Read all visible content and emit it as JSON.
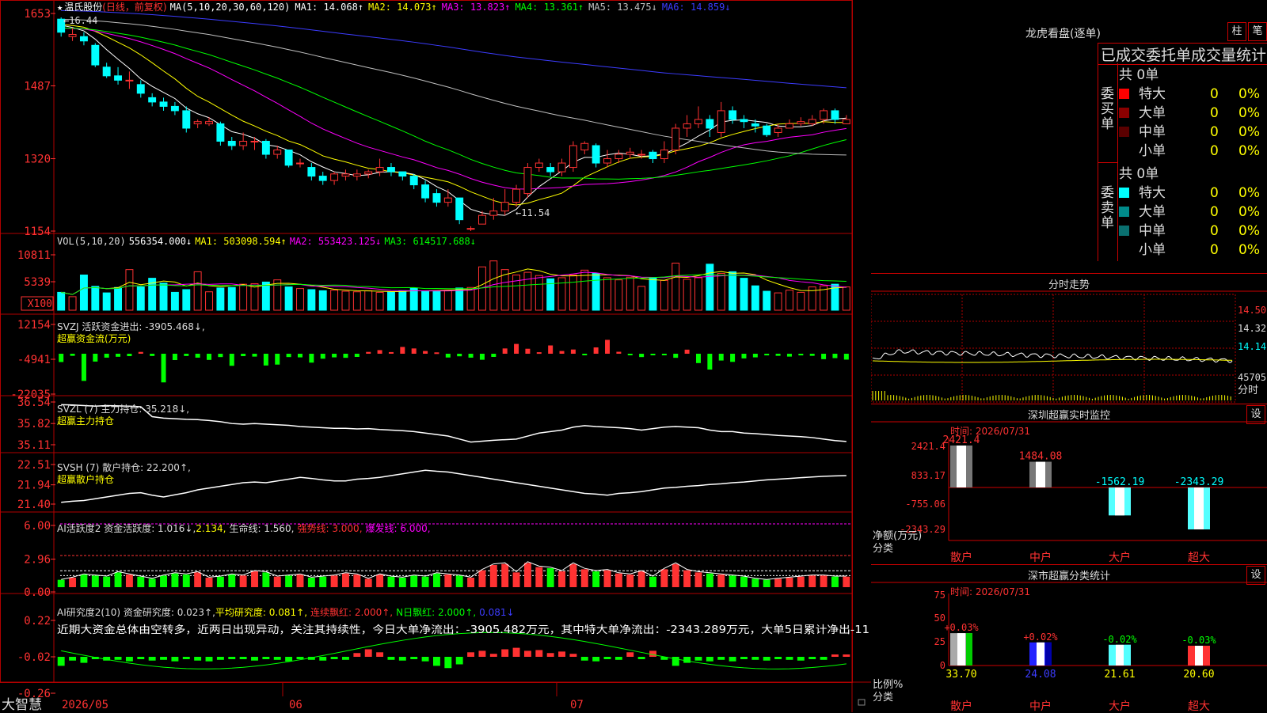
{
  "header": {
    "star": "★",
    "stock_name": "温氏股份",
    "period": "(日线，前复权)",
    "ma_label": "MA(5,10,20,30,60,120)",
    "ma1": "MA1: 14.068↑",
    "ma2": "MA2: 14.073↑",
    "ma3": "MA3: 13.823↑",
    "ma4": "MA4: 13.361↑",
    "ma5": "MA5: 13.475↓",
    "ma6": "MA6: 14.859↓"
  },
  "colors": {
    "up": "#ff3232",
    "down": "#00ffff",
    "ma1": "#ffffff",
    "ma2": "#ffff00",
    "ma3": "#ff00ff",
    "ma4": "#00ff00",
    "ma5": "#c0c0c0",
    "ma6": "#3c3cff",
    "grid": "#b00000"
  },
  "price_axis": [
    "1653",
    "1487",
    "1320",
    "1154"
  ],
  "price_notes": {
    "high": "←16.44",
    "low": "←11.54"
  },
  "vol_header": {
    "label": "VOL(5,10,20)",
    "value": "556354.000↓",
    "ma1": "MA1: 503098.594↑",
    "ma2": "MA2: 553423.125↓",
    "ma3": "MA3: 614517.688↓"
  },
  "vol_axis": [
    "10811",
    "5339"
  ],
  "vol_unit": "X100",
  "svzj": {
    "label": "SVZJ  活跃资金进出: -3905.468↓,",
    "sub": "超赢资金流(万元)",
    "axis": [
      "12154",
      "-4941",
      "-22035"
    ]
  },
  "svzl": {
    "label": "SVZL (7) 主力持仓: 35.218↓,",
    "sub": "超赢主力持仓",
    "axis": [
      "36.54",
      "35.82",
      "35.11"
    ]
  },
  "svsh": {
    "label": "SVSH (7) 散户持仓: 22.200↑,",
    "sub": "超赢散户持仓",
    "axis": [
      "22.51",
      "21.94",
      "21.40"
    ]
  },
  "ai_active": {
    "label": "AI活跃度2 资金活跃度: 1.016↓,",
    "v2": "2.134,",
    "life": "生命线: 1.560,",
    "strong": "强势线: 3.000,",
    "burst": "爆发线: 6.000,",
    "axis": [
      "6.00",
      "2.96",
      "0.00"
    ]
  },
  "ai_research": {
    "label": "AI研究度2(10) 资金研究度: 0.023↑,",
    "avg": "平均研究度: 0.081↑,",
    "cont": "连续飘红: 2.000↑,",
    "nday": "N日飘红: 2.000↑,",
    "last": "0.081↓",
    "axis": [
      "0.22",
      "-0.02",
      "-0.26"
    ]
  },
  "comment": "近期大资金总体由空转多，近两日出现异动，关注其持续性，今日大单净流出：-3905.482万元，其中特大单净流出：-2343.289万元，大单5日累计净出-11",
  "x_axis": {
    "brand": "大智慧",
    "labels": [
      "2026/05",
      "06",
      "07"
    ]
  },
  "lhb": {
    "title": "龙虎看盘(逐单)",
    "btn_zhu": "柱",
    "btn_bi": "笔",
    "heading": "已成交委托单成交量统计",
    "buy_label": "委买单",
    "sell_label": "委卖单",
    "buy_total": "共 0单",
    "sell_total": "共 0单",
    "buy_rows": [
      {
        "name": "特大",
        "count": "0",
        "pct": "0%",
        "color": "#ff0000"
      },
      {
        "name": "大单",
        "count": "0",
        "pct": "0%",
        "color": "#8b0000"
      },
      {
        "name": "中单",
        "count": "0",
        "pct": "0%",
        "color": "#5a0000"
      },
      {
        "name": "小单",
        "count": "0",
        "pct": "0%",
        "color": ""
      }
    ],
    "sell_rows": [
      {
        "name": "特大",
        "count": "0",
        "pct": "0%",
        "color": "#00ffff"
      },
      {
        "name": "大单",
        "count": "0",
        "pct": "0%",
        "color": "#008b8b"
      },
      {
        "name": "中单",
        "count": "0",
        "pct": "0%",
        "color": "#0a7070"
      },
      {
        "name": "小单",
        "count": "0",
        "pct": "0%",
        "color": ""
      }
    ]
  },
  "intraday": {
    "title": "分时走势",
    "axis": [
      "14.50",
      "14.32",
      "14.14",
      "45705"
    ],
    "unit": "分时"
  },
  "monitor": {
    "title": "深圳超赢实时监控",
    "btn": "设",
    "time": "时间: 2026/07/31",
    "axis": [
      "2421.4",
      "833.17",
      "-755.06",
      "-2343.29"
    ],
    "ylabel": "净额(万元)",
    "xlabel": "分类",
    "categories": [
      "散户",
      "中户",
      "大户",
      "超大"
    ],
    "values": [
      2421.4,
      1484.08,
      -1562.19,
      -2343.29
    ],
    "value_labels": [
      "2421.4",
      "1484.08",
      "-1562.19",
      "-2343.29"
    ]
  },
  "stats": {
    "title": "深市超赢分类统计",
    "btn": "设",
    "time": "时间: 2026/07/31",
    "axis": [
      "75",
      "50",
      "25",
      "0"
    ],
    "ylabel": "比例%",
    "xlabel": "分类",
    "categories": [
      "散户",
      "中户",
      "大户",
      "超大"
    ],
    "values": [
      33.7,
      24.08,
      21.61,
      20.6
    ],
    "value_labels": [
      "33.70",
      "24.08",
      "21.61",
      "20.60"
    ],
    "change_labels": [
      "+0.03%",
      "+0.02%",
      "-0.02%",
      "-0.03%"
    ]
  },
  "chart_data": [
    {
      "type": "candlestick",
      "title": "温氏股份 (日线，前复权)",
      "x_labels": [
        "2026/05",
        "06",
        "07"
      ],
      "ylim": [
        11.54,
        16.44
      ],
      "candles": [
        [
          16.4,
          16.1,
          16.44,
          16.0
        ],
        [
          16.0,
          16.05,
          16.2,
          15.9
        ],
        [
          16.0,
          15.9,
          16.1,
          15.8
        ],
        [
          15.8,
          15.35,
          15.85,
          15.3
        ],
        [
          15.3,
          15.1,
          15.4,
          15.05
        ],
        [
          15.1,
          15.0,
          15.3,
          14.9
        ],
        [
          15.0,
          15.0,
          15.2,
          14.8
        ],
        [
          14.9,
          14.7,
          15.0,
          14.6
        ],
        [
          14.6,
          14.5,
          14.7,
          14.4
        ],
        [
          14.5,
          14.4,
          14.6,
          14.3
        ],
        [
          14.4,
          14.3,
          14.5,
          14.2
        ],
        [
          14.3,
          13.9,
          14.4,
          13.8
        ],
        [
          14.0,
          14.05,
          14.1,
          13.9
        ],
        [
          14.0,
          14.05,
          14.15,
          13.95
        ],
        [
          14.0,
          13.6,
          14.05,
          13.5
        ],
        [
          13.6,
          13.5,
          13.7,
          13.4
        ],
        [
          13.5,
          13.6,
          13.8,
          13.4
        ],
        [
          13.6,
          13.6,
          13.7,
          13.4
        ],
        [
          13.6,
          13.3,
          13.65,
          13.2
        ],
        [
          13.3,
          13.4,
          13.5,
          13.2
        ],
        [
          13.4,
          13.05,
          13.4,
          13.0
        ],
        [
          13.1,
          13.1,
          13.2,
          13.0
        ],
        [
          13.0,
          12.8,
          13.1,
          12.7
        ],
        [
          12.8,
          12.7,
          12.9,
          12.6
        ],
        [
          12.7,
          12.85,
          12.9,
          12.6
        ],
        [
          12.8,
          12.85,
          12.95,
          12.7
        ],
        [
          12.8,
          12.85,
          12.95,
          12.7
        ],
        [
          12.85,
          12.9,
          12.95,
          12.75
        ],
        [
          12.9,
          13.0,
          13.2,
          12.8
        ],
        [
          13.0,
          12.9,
          13.1,
          12.8
        ],
        [
          12.9,
          12.8,
          12.9,
          12.7
        ],
        [
          12.8,
          12.6,
          12.85,
          12.5
        ],
        [
          12.6,
          12.3,
          12.7,
          12.2
        ],
        [
          12.4,
          12.2,
          12.5,
          12.1
        ],
        [
          12.2,
          12.3,
          12.5,
          12.1
        ],
        [
          12.3,
          11.8,
          12.3,
          11.7
        ],
        [
          11.6,
          11.6,
          11.65,
          11.54
        ],
        [
          11.7,
          11.9,
          12.0,
          11.7
        ],
        [
          11.9,
          12.0,
          12.3,
          11.8
        ],
        [
          12.0,
          12.2,
          12.5,
          11.9
        ],
        [
          12.2,
          12.5,
          12.6,
          12.1
        ],
        [
          12.4,
          13.0,
          13.1,
          12.3
        ],
        [
          13.0,
          13.1,
          13.2,
          12.9
        ],
        [
          13.0,
          12.9,
          13.1,
          12.8
        ],
        [
          12.9,
          13.1,
          13.2,
          12.8
        ],
        [
          13.0,
          13.5,
          13.6,
          12.9
        ],
        [
          13.4,
          13.55,
          13.6,
          13.3
        ],
        [
          13.5,
          13.1,
          13.55,
          13.0
        ],
        [
          13.1,
          13.2,
          13.4,
          13.0
        ],
        [
          13.2,
          13.3,
          13.4,
          13.1
        ],
        [
          13.3,
          13.35,
          13.45,
          13.2
        ],
        [
          13.3,
          13.3,
          13.4,
          13.2
        ],
        [
          13.35,
          13.2,
          13.4,
          13.1
        ],
        [
          13.2,
          13.4,
          13.6,
          13.1
        ],
        [
          13.4,
          13.9,
          14.0,
          13.3
        ],
        [
          13.9,
          14.0,
          14.2,
          13.7
        ],
        [
          14.0,
          14.1,
          14.4,
          13.9
        ],
        [
          14.1,
          13.9,
          14.2,
          13.7
        ],
        [
          13.8,
          14.3,
          14.5,
          13.7
        ],
        [
          14.3,
          14.1,
          14.4,
          14.0
        ],
        [
          14.1,
          14.05,
          14.2,
          13.9
        ],
        [
          14.0,
          13.95,
          14.1,
          13.8
        ],
        [
          13.95,
          13.75,
          14.0,
          13.7
        ],
        [
          13.8,
          13.9,
          14.0,
          13.7
        ],
        [
          13.9,
          14.0,
          14.1,
          13.9
        ],
        [
          14.0,
          14.05,
          14.15,
          13.95
        ],
        [
          14.0,
          14.1,
          14.2,
          13.95
        ],
        [
          14.1,
          14.3,
          14.35,
          14.0
        ],
        [
          14.3,
          14.1,
          14.35,
          14.0
        ],
        [
          14.0,
          14.1,
          14.2,
          14.0
        ]
      ]
    },
    {
      "type": "bar",
      "title": "VOL(5,10,20)",
      "ylim": [
        0,
        10811
      ],
      "values": [
        3300,
        2500,
        6500,
        4400,
        3200,
        4200,
        7500,
        4300,
        5900,
        5000,
        3300,
        3800,
        7100,
        3400,
        4100,
        4200,
        4800,
        4900,
        5200,
        5600,
        4300,
        4000,
        3800,
        3600,
        3700,
        3500,
        3400,
        3600,
        3300,
        3400,
        3600,
        4100,
        3500,
        3600,
        3700,
        4100,
        4200,
        8000,
        9100,
        7500,
        6500,
        7000,
        6400,
        5800,
        6000,
        6500,
        7400,
        6800,
        6000,
        5600,
        6100,
        4400,
        6000,
        5500,
        8700,
        5700,
        6000,
        8500,
        6800,
        7100,
        5900,
        4500,
        3500,
        3200,
        3700,
        3300,
        4300,
        4500,
        4800,
        4300
      ]
    },
    {
      "type": "bar",
      "title": "超赢资金流(万元)",
      "ylim": [
        -22035,
        12154
      ],
      "values": [
        -5500,
        -1400,
        -18000,
        -5200,
        -2600,
        -2000,
        -1600,
        1200,
        -1500,
        -19000,
        -4200,
        -1500,
        -2600,
        -4100,
        -2200,
        -8000,
        -1600,
        -1900,
        -7800,
        -7200,
        -2200,
        -2400,
        -5900,
        -3300,
        -2400,
        -2700,
        -2100,
        1200,
        2400,
        1100,
        4500,
        3500,
        1800,
        900,
        -2500,
        -1700,
        -2600,
        -4000,
        -2100,
        3500,
        6500,
        3300,
        1000,
        5500,
        1800,
        2800,
        -700,
        4200,
        9200,
        1300,
        -700,
        -2200,
        -600,
        -600,
        -2700,
        2700,
        -6200,
        -10500,
        -4500,
        -5400,
        -3100,
        -2400,
        -1100,
        -1400,
        -1900,
        -1100,
        -1400,
        -3600,
        -2900,
        -3900
      ]
    },
    {
      "type": "line",
      "title": "超赢主力持仓",
      "ylim": [
        35.11,
        36.54
      ],
      "values": [
        36.45,
        36.44,
        36.42,
        36.4,
        36.42,
        36.41,
        36.4,
        36.38,
        36.05,
        36.0,
        35.98,
        35.96,
        35.95,
        35.92,
        35.88,
        35.82,
        35.8,
        35.82,
        35.8,
        35.78,
        35.76,
        35.72,
        35.7,
        35.68,
        35.66,
        35.66,
        35.64,
        35.65,
        35.62,
        35.6,
        35.58,
        35.55,
        35.5,
        35.45,
        35.4,
        35.3,
        35.2,
        35.23,
        35.26,
        35.28,
        35.3,
        35.4,
        35.5,
        35.55,
        35.6,
        35.7,
        35.75,
        35.72,
        35.7,
        35.68,
        35.65,
        35.6,
        35.65,
        35.7,
        35.72,
        35.7,
        35.68,
        35.6,
        35.55,
        35.55,
        35.5,
        35.48,
        35.45,
        35.42,
        35.4,
        35.38,
        35.35,
        35.3,
        35.25,
        35.22
      ]
    },
    {
      "type": "line",
      "title": "超赢散户持仓",
      "ylim": [
        21.4,
        22.51
      ],
      "values": [
        21.45,
        21.48,
        21.5,
        21.55,
        21.6,
        21.65,
        21.7,
        21.72,
        21.65,
        21.6,
        21.66,
        21.72,
        21.8,
        21.85,
        21.9,
        21.95,
        22.0,
        22.02,
        22.0,
        22.05,
        22.1,
        22.15,
        22.12,
        22.08,
        22.05,
        22.05,
        22.1,
        22.12,
        22.15,
        22.2,
        22.25,
        22.3,
        22.35,
        22.32,
        22.3,
        22.25,
        22.2,
        22.15,
        22.1,
        22.05,
        22.0,
        21.95,
        21.9,
        21.85,
        21.8,
        21.75,
        21.7,
        21.68,
        21.65,
        21.7,
        21.72,
        21.75,
        21.8,
        21.85,
        21.87,
        21.9,
        21.92,
        21.95,
        21.97,
        22.0,
        22.02,
        22.05,
        22.08,
        22.1,
        22.12,
        22.14,
        22.16,
        22.18,
        22.19,
        22.2
      ]
    },
    {
      "type": "bar",
      "title": "AI活跃度2",
      "ylim": [
        0,
        6.0
      ],
      "values": [
        0.7,
        0.9,
        1.2,
        1.1,
        1.0,
        1.4,
        1.2,
        1.0,
        0.8,
        1.1,
        1.3,
        1.2,
        1.4,
        0.9,
        1.0,
        1.2,
        1.1,
        1.5,
        1.4,
        1.0,
        1.1,
        1.2,
        0.9,
        1.0,
        1.1,
        1.3,
        1.2,
        0.8,
        1.2,
        1.0,
        0.9,
        1.1,
        1.0,
        1.3,
        1.2,
        1.1,
        0.9,
        1.6,
        2.1,
        2.2,
        1.4,
        2.3,
        1.9,
        1.8,
        1.5,
        2.2,
        1.7,
        1.5,
        1.6,
        1.3,
        1.2,
        1.5,
        1.0,
        1.7,
        2.2,
        1.6,
        1.4,
        1.3,
        1.2,
        1.1,
        1.0,
        0.8,
        0.7,
        0.8,
        0.9,
        1.0,
        1.1,
        1.1,
        1.0,
        1.0
      ],
      "lines": {
        "life": 1.56,
        "strong": 3.0,
        "burst": 6.0
      }
    },
    {
      "type": "bar",
      "title": "AI研究度2(10)",
      "ylim": [
        -0.26,
        0.22
      ],
      "values": [
        -0.12,
        -0.05,
        -0.08,
        -0.03,
        -0.05,
        -0.04,
        -0.06,
        -0.03,
        -0.05,
        -0.04,
        -0.06,
        -0.03,
        -0.05,
        -0.06,
        -0.04,
        -0.03,
        -0.02,
        -0.05,
        -0.03,
        -0.04,
        -0.06,
        -0.03,
        -0.04,
        -0.05,
        -0.03,
        -0.04,
        0.05,
        0.1,
        0.06,
        -0.04,
        -0.05,
        -0.03,
        -0.06,
        -0.12,
        -0.15,
        -0.1,
        0.06,
        0.08,
        0.04,
        0.1,
        0.12,
        0.08,
        0.09,
        0.05,
        0.07,
        0.04,
        -0.05,
        -0.06,
        -0.03,
        -0.04,
        0.06,
        -0.03,
        0.08,
        -0.04,
        -0.12,
        -0.08,
        -0.05,
        -0.06,
        -0.04,
        -0.06,
        -0.03,
        -0.04,
        -0.05,
        -0.03,
        -0.04,
        -0.05,
        -0.03,
        -0.04,
        0.03,
        0.02
      ]
    }
  ]
}
